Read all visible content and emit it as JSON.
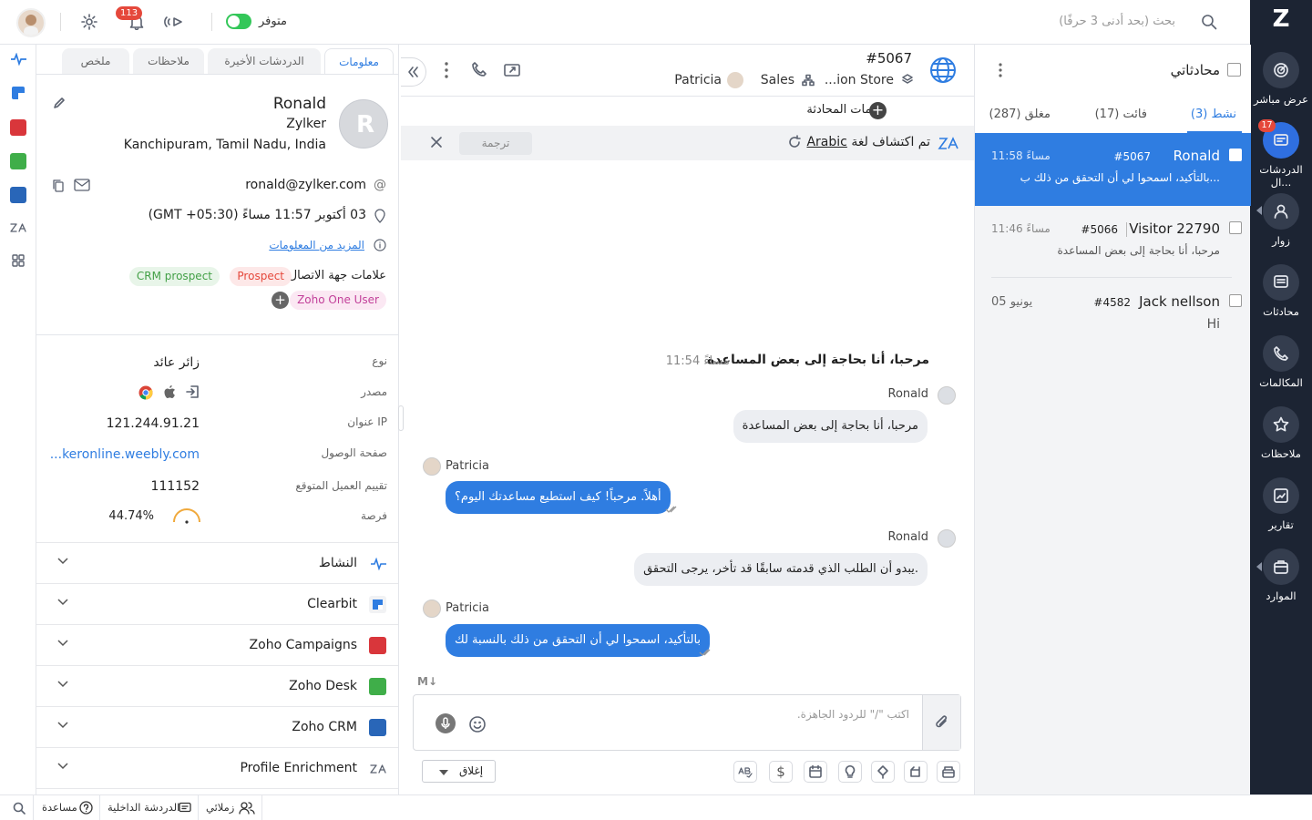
{
  "topbar": {
    "search_placeholder": "بحث (بحد أدنى 3 حرفًا)",
    "status": "متوفر",
    "notif_count": "113"
  },
  "rightnav": {
    "logo": "Z",
    "items": [
      {
        "label": "عرض مباشر"
      },
      {
        "label": "الدردشات ال...",
        "badge": "17"
      },
      {
        "label": "زوار"
      },
      {
        "label": "محادثات"
      },
      {
        "label": "المكالمات"
      },
      {
        "label": "ملاحظات"
      },
      {
        "label": "تقارير"
      },
      {
        "label": "الموارد"
      }
    ]
  },
  "chatlist": {
    "title": "محادثاتي",
    "tabs": [
      {
        "label": "نشط",
        "count": "(3)"
      },
      {
        "label": "فائت",
        "count": "(17)"
      },
      {
        "label": "مغلق",
        "count": "(287)"
      }
    ],
    "conversations": [
      {
        "name": "Ronald",
        "num": "#5067",
        "time": "11:58 مساءً",
        "msg": "بالتأكيد، اسمحوا لي أن التحقق من ذلك ب..."
      },
      {
        "name": "Visitor 22790",
        "num": "#5066",
        "time": "11:46 مساءً",
        "msg": "مرحبا، أنا بحاجة إلى بعض المساعدة"
      },
      {
        "name": "Jack nellson",
        "num": "#4582",
        "time": "05 يونيو",
        "msg": "Hi"
      }
    ]
  },
  "chat": {
    "id": "#5067",
    "store": "...ion Store",
    "dept": "Sales",
    "agent": "Patricia",
    "tags_label": "علامات المحادثة",
    "translate_notice_pre": "تم اكتشاف لغة",
    "translate_lang": "Arabic",
    "translate_btn": "ترجمة",
    "first_line": "مرحبا، أنا بحاجة إلى بعض المساعدة",
    "first_time": "11:54 مساءً",
    "messages": [
      {
        "sender": "Ronald",
        "text": "مرحبا، أنا بحاجة إلى بعض المساعدة"
      },
      {
        "sender": "Patricia",
        "text": "أهلاً. مرحباً! كيف استطيع مساعدتك اليوم؟"
      },
      {
        "sender": "Ronald",
        "text": "يبدو أن الطلب الذي قدمته سابقًا قد تأخر، يرجى التحقق."
      },
      {
        "sender": "Patricia",
        "text": "بالتأكيد، اسمحوا لي أن التحقق من ذلك بالنسبة لك"
      }
    ],
    "md": "M↓",
    "input_placeholder": "اكتب \"/\" للردود الجاهزة.",
    "close_btn": "إغلاق"
  },
  "visitor": {
    "tabs": [
      "معلومات",
      "الدردشات الأخيرة",
      "ملاحظات",
      "ملخص"
    ],
    "name": "Ronald",
    "company": "Zylker",
    "location": "Kanchipuram, Tamil Nadu, India",
    "email": "ronald@zylker.com",
    "datetime": "03 أكتوبر 11:57 مساءً (GMT +05:30)",
    "more_info": "المزيد من المعلومات",
    "contact_tags_label": "علامات جهة الاتصال",
    "tags": [
      "Prospect",
      "CRM prospect",
      "Zoho One User"
    ],
    "details": [
      {
        "label": "نوع",
        "value": "زائر عائد"
      },
      {
        "label": "مصدر",
        "value": ""
      },
      {
        "label": "عنوان IP",
        "value": "121.244.91.21"
      },
      {
        "label": "صفحة الوصول",
        "value": "...keronline.weebly.com"
      },
      {
        "label": "تقييم العميل المتوقع",
        "value": "111152"
      },
      {
        "label": "فرصة",
        "value": "44.74%"
      }
    ],
    "sections": [
      "النشاط",
      "Clearbit",
      "Zoho Campaigns",
      "Zoho Desk",
      "Zoho CRM",
      "Profile Enrichment"
    ]
  },
  "bottombar": {
    "items": [
      "زملائي",
      "الدردشة الداخلية",
      "مساعدة"
    ]
  },
  "colors": {
    "accent": "#2f7de1",
    "nav_bg": "#1c2433"
  }
}
